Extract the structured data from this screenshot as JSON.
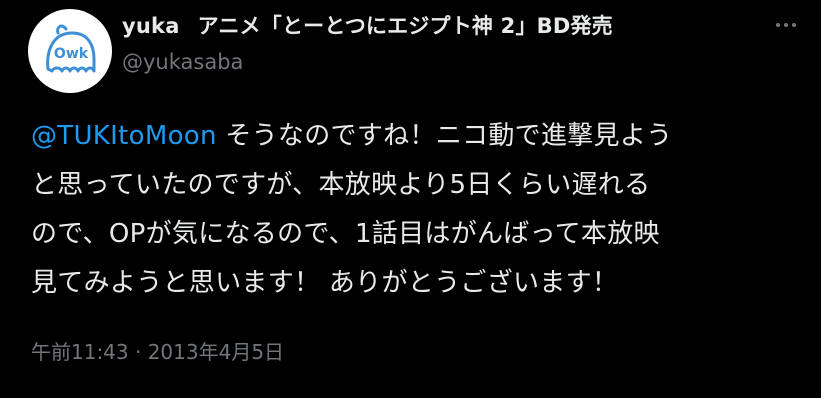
{
  "tweet": {
    "author": {
      "name": "yuka",
      "name_suffix": "アニメ「とーとつにエジプト神 2」BD発売",
      "handle": "@yukasaba",
      "avatar_icon": "ghost-mascot-icon"
    },
    "more_icon": "more-options-icon",
    "text": {
      "mention": "@TUKItoMoon",
      "line1_rest": " そうなのですね！ニコ動で進撃見よう",
      "line2": "と思っていたのですが、本放映より5日くらい遅れる",
      "line3": "ので、OPが気になるので、1話目はがんばって本放映",
      "line4": "見てみようと思います！ ありがとうございます！"
    },
    "timestamp": "午前11:43 · 2013年4月5日"
  },
  "colors": {
    "background": "#000000",
    "text": "#e7e9ea",
    "secondary": "#71767b",
    "link": "#1d9bf0",
    "avatar_accent": "#3d8fd6"
  }
}
